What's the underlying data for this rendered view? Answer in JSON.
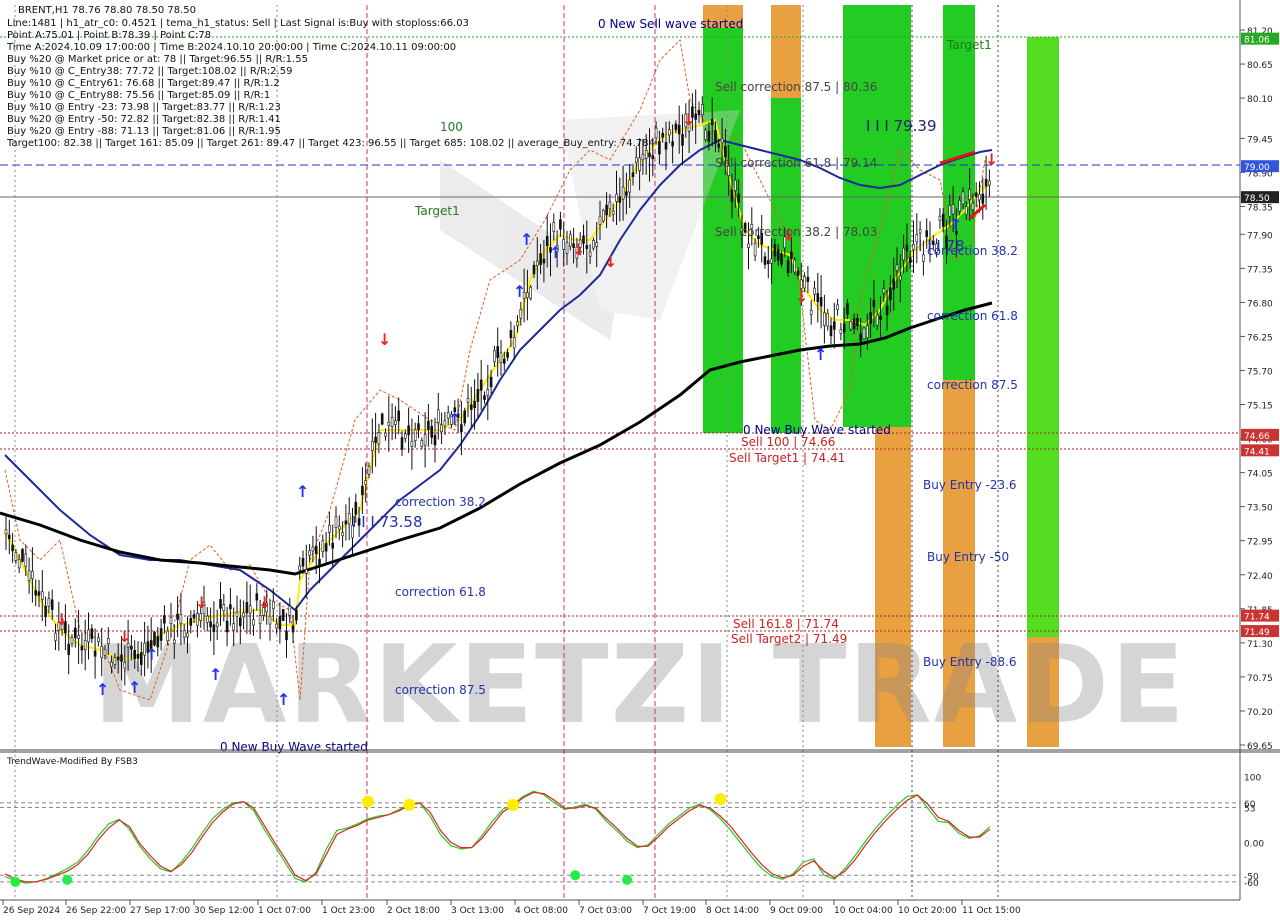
{
  "chart_data": {
    "type": "line",
    "symbol_line": "BRENT,H1  78.76 78.80 78.50 78.50",
    "info_lines": [
      "Line:1481 | h1_atr_c0: 0.4521 | tema_h1_status: Sell | Last Signal is:Buy with stoploss:66.03",
      "Point A:75.01 | Point B:78.39 | Point C:78",
      "Time A:2024.10.09 17:00:00 | Time B:2024.10.10 20:00:00 | Time C:2024.10.11 09:00:00",
      "Buy %20 @ Market price or at: 78 || Target:96.55 || R/R:1.55",
      "Buy %10 @ C_Entry38: 77.72 || Target:108.02 || R/R:2.59",
      "Buy %10 @ C_Entry61: 76.68 || Target:89.47 || R/R:1.2",
      "Buy %10 @ C_Entry88: 75.56 || Target:85.09 || R/R:1",
      "Buy %10 @ Entry -23: 73.98 || Target:83.77 || R/R:1.23",
      "Buy %20 @ Entry -50: 72.82 || Target:82.38 || R/R:1.41",
      "Buy %20 @ Entry -88: 71.13 || Target:81.06 || R/R:1.95",
      "Target100: 82.38 || Target 161: 85.09 || Target 261: 89.47 || Target 423: 96.55 || Target 685: 108.02 || average_Buy_entry: 74.784"
    ],
    "y_ticks": [
      "81.20",
      "80.65",
      "80.10",
      "79.45",
      "78.90",
      "78.35",
      "77.90",
      "77.35",
      "76.80",
      "76.25",
      "75.70",
      "75.15",
      "74.60",
      "74.05",
      "73.50",
      "72.95",
      "72.40",
      "71.85",
      "71.30",
      "70.75",
      "70.20",
      "69.65"
    ],
    "y_tick_values": [
      81.2,
      80.65,
      80.1,
      79.45,
      78.9,
      78.35,
      77.9,
      77.35,
      76.8,
      76.25,
      75.7,
      75.15,
      74.6,
      74.05,
      73.5,
      72.95,
      72.4,
      71.85,
      71.3,
      70.75,
      70.2,
      69.65
    ],
    "ylim": [
      69.5,
      81.5
    ],
    "price_tags": [
      {
        "label": "81.06",
        "value": 81.06,
        "color": "#22aa22"
      },
      {
        "label": "79.00",
        "value": 79.0,
        "color": "#3355dd"
      },
      {
        "label": "78.50",
        "value": 78.5,
        "color": "#222222"
      },
      {
        "label": "74.66",
        "value": 74.66,
        "color": "#cc3333"
      },
      {
        "label": "74.41",
        "value": 74.41,
        "color": "#cc3333"
      },
      {
        "label": "71.74",
        "value": 71.74,
        "color": "#cc3333"
      },
      {
        "label": "71.49",
        "value": 71.49,
        "color": "#cc3333"
      }
    ],
    "x_labels": [
      "26 Sep 2024",
      "26 Sep 22:00",
      "27 Sep 17:00",
      "30 Sep 12:00",
      "1 Oct 07:00",
      "1 Oct 23:00",
      "2 Oct 18:00",
      "3 Oct 13:00",
      "4 Oct 08:00",
      "7 Oct 03:00",
      "7 Oct 19:00",
      "8 Oct 14:00",
      "9 Oct 09:00",
      "10 Oct 04:00",
      "10 Oct 20:00",
      "11 Oct 15:00"
    ],
    "annotations": {
      "new_sell_wave": "0 New Sell wave started",
      "target1_right": "Target1",
      "level_100": "100",
      "sell_corr_875": "Sell correction 87.5 | 80.36",
      "sell_corr_618": "Sell correction 61.8 | 79.14",
      "sell_corr_382": "Sell correction 38.2 | 78.03",
      "target1_left": "Target1",
      "hi_7939": "I I I 79.39",
      "lo_78": "I I I 78",
      "corr_382_right": "correction 38.2",
      "corr_618_right": "correction 61.8",
      "corr_875_right": "correction 87.5",
      "new_buy_wave_mid": "0 New Buy Wave started",
      "sell_100": "Sell 100 | 74.66",
      "sell_target1": "Sell Target1 | 74.41",
      "buy_entry_23": "Buy Entry -23.6",
      "buy_entry_50": "Buy Entry -50",
      "corr_382_left": "correction 38.2",
      "lo_7358": "I I I 73.58",
      "corr_618_left": "correction 61.8",
      "sell_1618": "Sell 161.8 | 71.74",
      "sell_target2": "Sell Target2 | 71.49",
      "buy_entry_88": "Buy Entry -88.6",
      "corr_875_left": "correction 87.5",
      "new_buy_wave_left": "0 New Buy Wave started"
    },
    "watermark": "MARKETZI TRADE",
    "indicator": {
      "title": "TrendWave-Modified By FSB3",
      "y_ticks": [
        "100",
        "60",
        "53",
        "0.00",
        "-50",
        "-60"
      ],
      "y_tick_values": [
        100,
        60,
        53,
        0,
        -50,
        -60
      ],
      "ylim": [
        -80,
        110
      ],
      "series": [
        {
          "color": "#22cc22",
          "values": [
            -52,
            -58,
            -62,
            -60,
            -55,
            -48,
            -40,
            -30,
            -12,
            10,
            28,
            35,
            20,
            -6,
            -25,
            -40,
            -45,
            -30,
            -10,
            14,
            36,
            50,
            60,
            62,
            48,
            20,
            -5,
            -30,
            -55,
            -60,
            -45,
            -10,
            18,
            22,
            28,
            36,
            40,
            42,
            50,
            58,
            60,
            40,
            12,
            -5,
            -10,
            -8,
            10,
            32,
            50,
            58,
            70,
            78,
            72,
            60,
            50,
            54,
            58,
            50,
            32,
            18,
            2,
            -8,
            -4,
            12,
            28,
            40,
            52,
            58,
            50,
            36,
            18,
            -2,
            -22,
            -40,
            -52,
            -56,
            -48,
            -30,
            -25,
            -50,
            -56,
            -40,
            -20,
            2,
            22,
            40,
            56,
            70,
            72,
            52,
            32,
            30,
            14,
            6,
            10,
            24
          ]
        },
        {
          "color": "#dd2222",
          "values": [
            -48,
            -56,
            -60,
            -60,
            -56,
            -50,
            -44,
            -34,
            -18,
            4,
            22,
            34,
            24,
            -2,
            -20,
            -36,
            -44,
            -34,
            -16,
            8,
            30,
            46,
            58,
            62,
            52,
            26,
            0,
            -24,
            -50,
            -58,
            -48,
            -18,
            12,
            20,
            26,
            34,
            38,
            42,
            48,
            56,
            60,
            46,
            18,
            0,
            -8,
            -8,
            6,
            26,
            46,
            56,
            68,
            76,
            74,
            64,
            52,
            52,
            56,
            52,
            36,
            22,
            6,
            -6,
            -6,
            8,
            24,
            36,
            48,
            56,
            52,
            40,
            24,
            4,
            -16,
            -34,
            -48,
            -54,
            -50,
            -36,
            -28,
            -44,
            -54,
            -44,
            -26,
            -4,
            16,
            34,
            50,
            64,
            72,
            58,
            38,
            32,
            18,
            8,
            8,
            20
          ]
        }
      ],
      "yellow_dots": [
        {
          "i": 35,
          "v": 62
        },
        {
          "i": 39,
          "v": 57
        },
        {
          "i": 49,
          "v": 57
        },
        {
          "i": 69,
          "v": 66
        }
      ],
      "green_dots": [
        {
          "i": 1,
          "v": -60
        },
        {
          "i": 6,
          "v": -57
        },
        {
          "i": 55,
          "v": -50
        },
        {
          "i": 60,
          "v": -57
        }
      ]
    }
  }
}
